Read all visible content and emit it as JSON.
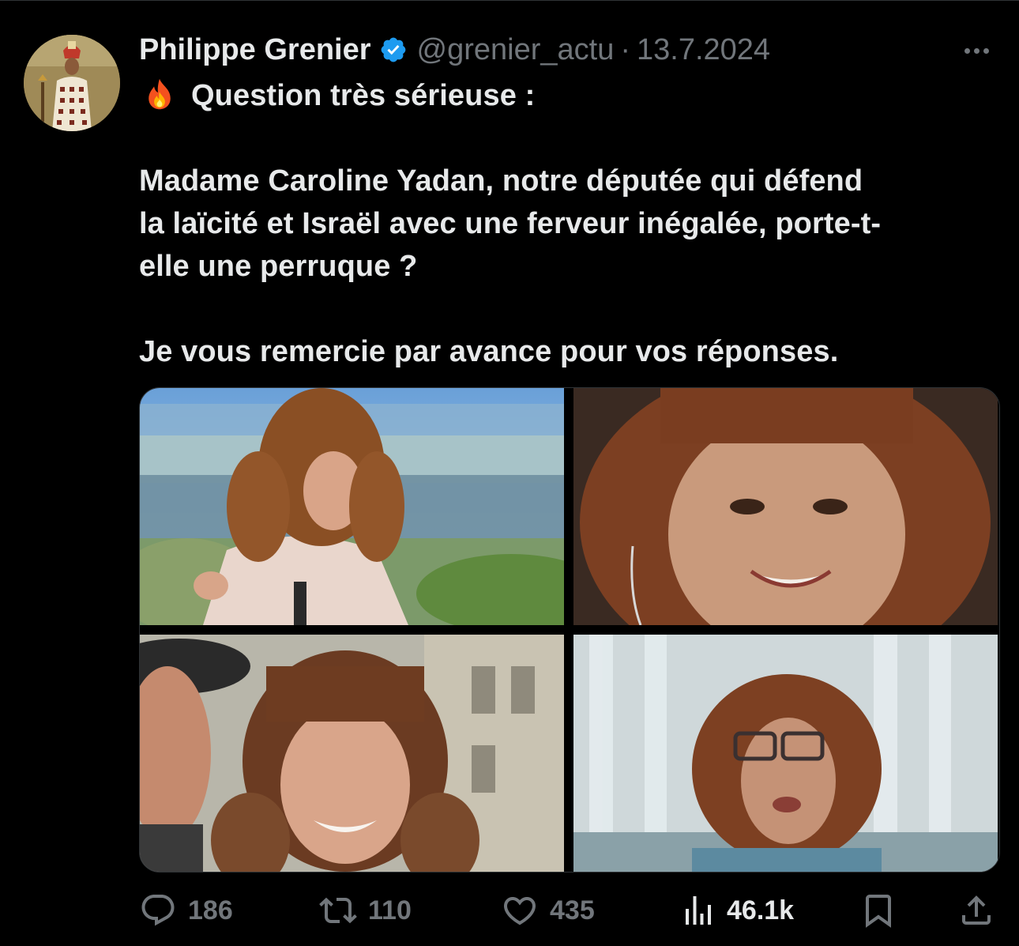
{
  "tweet": {
    "author": {
      "display_name": "Philippe Grenier",
      "handle": "@grenier_actu",
      "verified": true
    },
    "separator": "·",
    "date": "13.7.2024",
    "text_lines": [
      "Question très sérieuse :",
      "",
      "Madame Caroline Yadan, notre députée qui défend",
      "la laïcité et Israël avec une ferveur inégalée, porte-t-",
      "elle une perruque ?",
      "",
      "Je vous remercie par avance pour vos réponses."
    ],
    "leading_emoji": "fire-icon",
    "media": [
      {
        "kind": "photo",
        "scene": "tv-studio-city-backdrop"
      },
      {
        "kind": "photo",
        "scene": "closeup-portrait"
      },
      {
        "kind": "photo",
        "scene": "outdoor-street"
      },
      {
        "kind": "photo",
        "scene": "indoor-curtains-video"
      }
    ],
    "stats": {
      "replies": "186",
      "reposts": "110",
      "likes": "435",
      "views": "46.1k"
    }
  },
  "colors": {
    "background": "#000000",
    "text": "#e7e9ea",
    "muted": "#71767b",
    "verified_badge": "#1d9bf0",
    "divider": "#2f3336"
  }
}
